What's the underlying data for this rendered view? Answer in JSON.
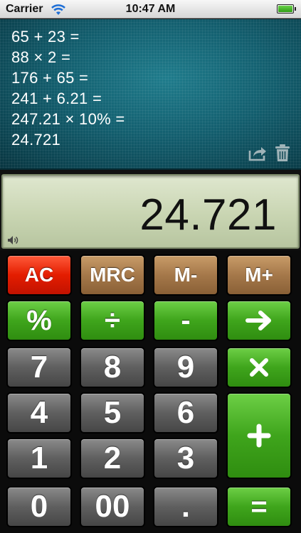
{
  "status_bar": {
    "carrier": "Carrier",
    "time": "10:47 AM",
    "wifi_icon": "wifi-icon",
    "battery_icon": "battery-icon",
    "battery_level": 1.0
  },
  "tape": {
    "lines": [
      "65 + 23 =",
      "88 × 2 =",
      "176 + 65 =",
      "241 + 6.21 =",
      "247.21 × 10% =",
      "24.721"
    ],
    "icons": [
      "share-icon",
      "trash-icon"
    ]
  },
  "display": {
    "value": "24.721",
    "icon": "speaker-icon"
  },
  "keys": {
    "ac": "AC",
    "mrc": "MRC",
    "m_minus": "M-",
    "m_plus": "M+",
    "percent": "%",
    "divide": "÷",
    "minus": "-",
    "seven": "7",
    "eight": "8",
    "nine": "9",
    "four": "4",
    "five": "5",
    "six": "6",
    "one": "1",
    "two": "2",
    "three": "3",
    "zero": "0",
    "double_zero": "00",
    "decimal": ".",
    "equals": "=",
    "arrow_icon": "arrow-right-icon",
    "multiply_icon": "multiply-icon",
    "plus_icon": "plus-icon"
  },
  "colors": {
    "function_red": "#e41d00",
    "memory_tan": "#a5784a",
    "operator_green": "#3fa51c",
    "digit_gray": "#5f5f5f",
    "tape_teal": "#135f6f",
    "display_lcd": "#c9d5b2"
  }
}
